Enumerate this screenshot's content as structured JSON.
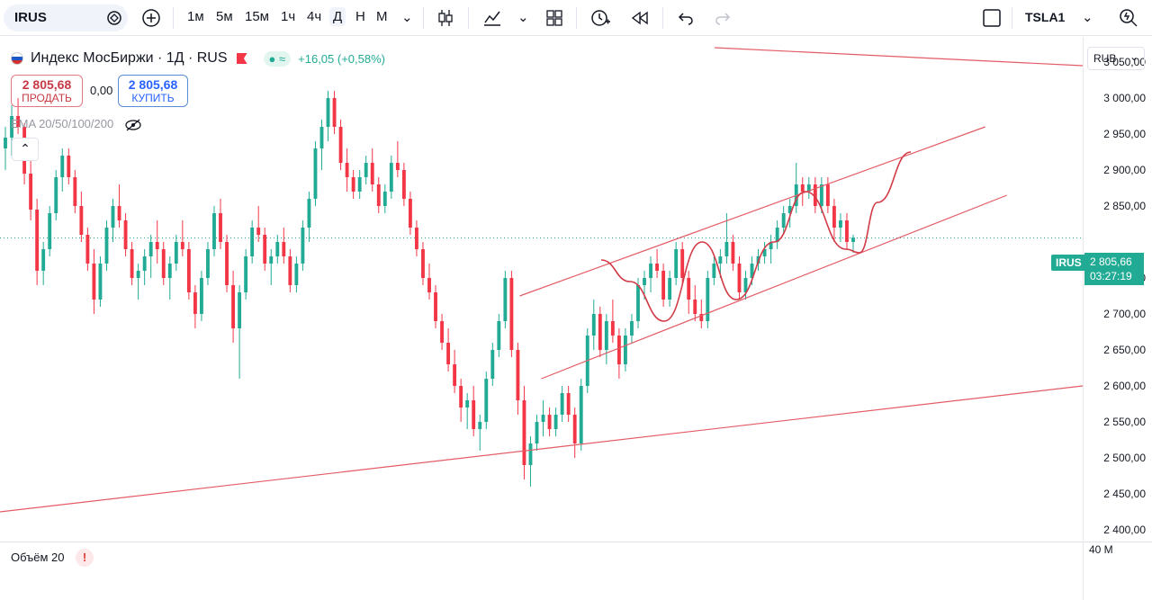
{
  "toolbar": {
    "symbol": "IRUS",
    "timeframes": [
      "1м",
      "5м",
      "15м",
      "1ч",
      "4ч",
      "Д",
      "Н",
      "М"
    ],
    "active_timeframe": "Д",
    "account": "TSLA1",
    "icons": [
      "search-icon",
      "add-symbol-icon",
      "timeframe-menu-icon",
      "candles-icon",
      "indicators-icon",
      "chart-type-menu-icon",
      "layout-icon",
      "alert-icon",
      "replay-icon",
      "undo-icon",
      "redo-icon",
      "fullscreen-icon",
      "account-menu-icon",
      "quick-search-icon"
    ]
  },
  "legend": {
    "title": "Индекс МосБиржи · 1Д · RUS",
    "change": "+16,05 (+0,58%)",
    "sell_price": "2 805,68",
    "sell_label": "ПРОДАТЬ",
    "spread": "0,00",
    "buy_price": "2 805,68",
    "buy_label": "КУПИТЬ",
    "ema_label": "EMA 20/50/100/200"
  },
  "price_axis": {
    "currency": "RUB",
    "labels": [
      "3 050,00",
      "3 000,00",
      "2 950,00",
      "2 900,00",
      "2 850,00",
      "2 750,00",
      "2 700,00",
      "2 650,00",
      "2 600,00",
      "2 550,00",
      "2 500,00",
      "2 450,00",
      "2 400,00"
    ],
    "current_symbol": "IRUS",
    "current_price": "2 805,66",
    "countdown": "03:27:19"
  },
  "volume": {
    "label": "Объём 20",
    "axis_label": "40 M"
  },
  "colors": {
    "up": "#22ab94",
    "down": "#f23645",
    "trendline": "#e35b66",
    "accent": "#2962ff"
  },
  "chart_data": {
    "type": "candlestick",
    "ylim": [
      2400,
      3070
    ],
    "series": [
      {
        "name": "IRUS",
        "ohlc": [
          [
            2930,
            2960,
            2900,
            2945
          ],
          [
            2945,
            2990,
            2920,
            2975
          ],
          [
            2975,
            3000,
            2950,
            2960
          ],
          [
            2960,
            2965,
            2880,
            2895
          ],
          [
            2895,
            2920,
            2830,
            2845
          ],
          [
            2845,
            2860,
            2740,
            2760
          ],
          [
            2760,
            2800,
            2740,
            2790
          ],
          [
            2790,
            2850,
            2780,
            2840
          ],
          [
            2840,
            2900,
            2830,
            2890
          ],
          [
            2890,
            2930,
            2870,
            2920
          ],
          [
            2920,
            2930,
            2880,
            2890
          ],
          [
            2890,
            2900,
            2840,
            2850
          ],
          [
            2850,
            2870,
            2800,
            2810
          ],
          [
            2810,
            2820,
            2760,
            2770
          ],
          [
            2770,
            2790,
            2700,
            2720
          ],
          [
            2720,
            2780,
            2710,
            2770
          ],
          [
            2770,
            2830,
            2760,
            2820
          ],
          [
            2820,
            2860,
            2800,
            2850
          ],
          [
            2850,
            2880,
            2820,
            2830
          ],
          [
            2830,
            2840,
            2780,
            2790
          ],
          [
            2790,
            2800,
            2740,
            2750
          ],
          [
            2750,
            2770,
            2720,
            2760
          ],
          [
            2760,
            2790,
            2740,
            2780
          ],
          [
            2780,
            2810,
            2750,
            2800
          ],
          [
            2800,
            2830,
            2770,
            2790
          ],
          [
            2790,
            2800,
            2740,
            2750
          ],
          [
            2750,
            2780,
            2720,
            2770
          ],
          [
            2770,
            2810,
            2760,
            2800
          ],
          [
            2800,
            2830,
            2780,
            2790
          ],
          [
            2790,
            2800,
            2720,
            2730
          ],
          [
            2730,
            2740,
            2680,
            2700
          ],
          [
            2700,
            2760,
            2690,
            2750
          ],
          [
            2750,
            2800,
            2740,
            2790
          ],
          [
            2790,
            2850,
            2780,
            2840
          ],
          [
            2840,
            2860,
            2790,
            2800
          ],
          [
            2800,
            2810,
            2730,
            2740
          ],
          [
            2740,
            2760,
            2660,
            2680
          ],
          [
            2680,
            2740,
            2610,
            2730
          ],
          [
            2730,
            2790,
            2720,
            2780
          ],
          [
            2780,
            2830,
            2770,
            2820
          ],
          [
            2820,
            2850,
            2800,
            2810
          ],
          [
            2810,
            2820,
            2760,
            2770
          ],
          [
            2770,
            2790,
            2740,
            2780
          ],
          [
            2780,
            2810,
            2770,
            2800
          ],
          [
            2800,
            2820,
            2770,
            2780
          ],
          [
            2780,
            2790,
            2730,
            2740
          ],
          [
            2740,
            2780,
            2730,
            2770
          ],
          [
            2770,
            2830,
            2760,
            2820
          ],
          [
            2820,
            2870,
            2800,
            2860
          ],
          [
            2860,
            2940,
            2850,
            2930
          ],
          [
            2930,
            2970,
            2900,
            2960
          ],
          [
            2960,
            3010,
            2940,
            3000
          ],
          [
            3000,
            3010,
            2950,
            2960
          ],
          [
            2960,
            2970,
            2900,
            2910
          ],
          [
            2910,
            2930,
            2870,
            2890
          ],
          [
            2890,
            2900,
            2860,
            2870
          ],
          [
            2870,
            2900,
            2860,
            2890
          ],
          [
            2890,
            2920,
            2880,
            2910
          ],
          [
            2910,
            2930,
            2870,
            2880
          ],
          [
            2880,
            2890,
            2840,
            2850
          ],
          [
            2850,
            2880,
            2840,
            2870
          ],
          [
            2870,
            2920,
            2860,
            2910
          ],
          [
            2910,
            2940,
            2890,
            2900
          ],
          [
            2900,
            2910,
            2850,
            2860
          ],
          [
            2860,
            2870,
            2810,
            2820
          ],
          [
            2820,
            2830,
            2780,
            2790
          ],
          [
            2790,
            2800,
            2740,
            2750
          ],
          [
            2750,
            2770,
            2720,
            2730
          ],
          [
            2730,
            2740,
            2680,
            2690
          ],
          [
            2690,
            2700,
            2650,
            2660
          ],
          [
            2660,
            2680,
            2620,
            2630
          ],
          [
            2630,
            2650,
            2590,
            2600
          ],
          [
            2600,
            2610,
            2550,
            2570
          ],
          [
            2570,
            2590,
            2540,
            2580
          ],
          [
            2580,
            2600,
            2530,
            2540
          ],
          [
            2540,
            2560,
            2510,
            2550
          ],
          [
            2550,
            2620,
            2540,
            2610
          ],
          [
            2610,
            2660,
            2600,
            2650
          ],
          [
            2650,
            2700,
            2640,
            2690
          ],
          [
            2690,
            2760,
            2680,
            2750
          ],
          [
            2750,
            2760,
            2640,
            2650
          ],
          [
            2650,
            2660,
            2560,
            2580
          ],
          [
            2580,
            2600,
            2470,
            2490
          ],
          [
            2490,
            2530,
            2460,
            2520
          ],
          [
            2520,
            2560,
            2510,
            2550
          ],
          [
            2550,
            2580,
            2530,
            2560
          ],
          [
            2560,
            2570,
            2530,
            2540
          ],
          [
            2540,
            2570,
            2530,
            2560
          ],
          [
            2560,
            2600,
            2550,
            2590
          ],
          [
            2590,
            2600,
            2550,
            2560
          ],
          [
            2560,
            2570,
            2500,
            2520
          ],
          [
            2520,
            2610,
            2510,
            2600
          ],
          [
            2600,
            2680,
            2590,
            2670
          ],
          [
            2670,
            2720,
            2650,
            2700
          ],
          [
            2700,
            2710,
            2640,
            2650
          ],
          [
            2650,
            2700,
            2630,
            2690
          ],
          [
            2690,
            2720,
            2660,
            2670
          ],
          [
            2670,
            2680,
            2610,
            2630
          ],
          [
            2630,
            2680,
            2620,
            2670
          ],
          [
            2670,
            2700,
            2660,
            2690
          ],
          [
            2690,
            2750,
            2680,
            2740
          ],
          [
            2740,
            2760,
            2720,
            2750
          ],
          [
            2750,
            2780,
            2730,
            2770
          ],
          [
            2770,
            2790,
            2750,
            2760
          ],
          [
            2760,
            2770,
            2710,
            2720
          ],
          [
            2720,
            2760,
            2710,
            2750
          ],
          [
            2750,
            2800,
            2740,
            2790
          ],
          [
            2790,
            2800,
            2740,
            2750
          ],
          [
            2750,
            2760,
            2700,
            2720
          ],
          [
            2720,
            2740,
            2690,
            2700
          ],
          [
            2700,
            2720,
            2680,
            2690
          ],
          [
            2690,
            2760,
            2680,
            2750
          ],
          [
            2750,
            2780,
            2740,
            2770
          ],
          [
            2770,
            2790,
            2750,
            2780
          ],
          [
            2780,
            2840,
            2770,
            2800
          ],
          [
            2800,
            2810,
            2760,
            2770
          ],
          [
            2770,
            2780,
            2720,
            2730
          ],
          [
            2730,
            2760,
            2720,
            2750
          ],
          [
            2750,
            2780,
            2740,
            2770
          ],
          [
            2770,
            2790,
            2760,
            2780
          ],
          [
            2780,
            2800,
            2770,
            2790
          ],
          [
            2790,
            2810,
            2770,
            2800
          ],
          [
            2800,
            2830,
            2790,
            2820
          ],
          [
            2820,
            2850,
            2810,
            2840
          ],
          [
            2840,
            2860,
            2820,
            2850
          ],
          [
            2850,
            2910,
            2840,
            2880
          ],
          [
            2880,
            2890,
            2850,
            2870
          ],
          [
            2870,
            2890,
            2860,
            2880
          ],
          [
            2880,
            2890,
            2840,
            2850
          ],
          [
            2850,
            2890,
            2840,
            2880
          ],
          [
            2880,
            2890,
            2840,
            2850
          ],
          [
            2850,
            2860,
            2800,
            2820
          ],
          [
            2820,
            2840,
            2800,
            2830
          ],
          [
            2830,
            2840,
            2790,
            2800
          ],
          [
            2800,
            2810,
            2785,
            2806
          ]
        ]
      }
    ],
    "trendlines": [
      {
        "name": "support-long",
        "from": [
          0,
          2425
        ],
        "to": [
          1,
          2600
        ]
      },
      {
        "name": "resistance-long",
        "from": [
          0.66,
          3070
        ],
        "to": [
          1,
          3045
        ]
      },
      {
        "name": "channel-upper",
        "from": [
          0.48,
          2725
        ],
        "to": [
          0.91,
          2960
        ]
      },
      {
        "name": "channel-lower",
        "from": [
          0.5,
          2610
        ],
        "to": [
          0.93,
          2865
        ]
      }
    ],
    "current_price": 2805.66
  }
}
